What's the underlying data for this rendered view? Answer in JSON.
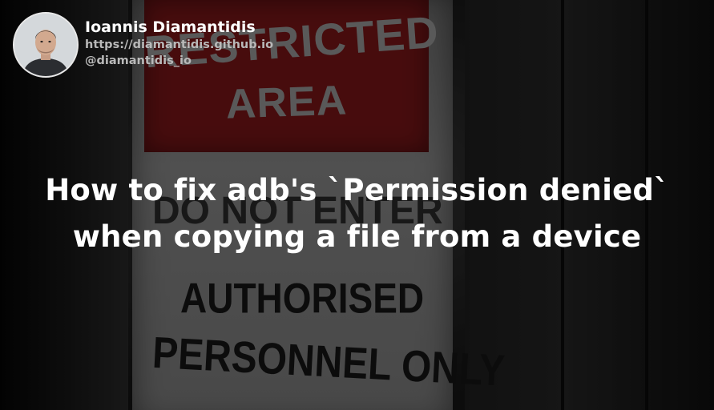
{
  "author": {
    "name": "Ioannis Diamantidis",
    "website": "https://diamantidis.github.io",
    "handle": "@diamantidis_io"
  },
  "post": {
    "title_line1": "How to fix adb's `Permission denied`",
    "title_line2": "when copying a file from a device"
  },
  "background": {
    "sign_line1": "RESTRICTED",
    "sign_line2": "AREA",
    "sign_line3": "DO NOT ENTER",
    "sign_line4": "AUTHORISED",
    "sign_line5": "PERSONNEL ONLY"
  },
  "colors": {
    "title_text": "#ffffff",
    "secondary_text": "#b9b9b9",
    "sign_red": "#7a1618"
  }
}
